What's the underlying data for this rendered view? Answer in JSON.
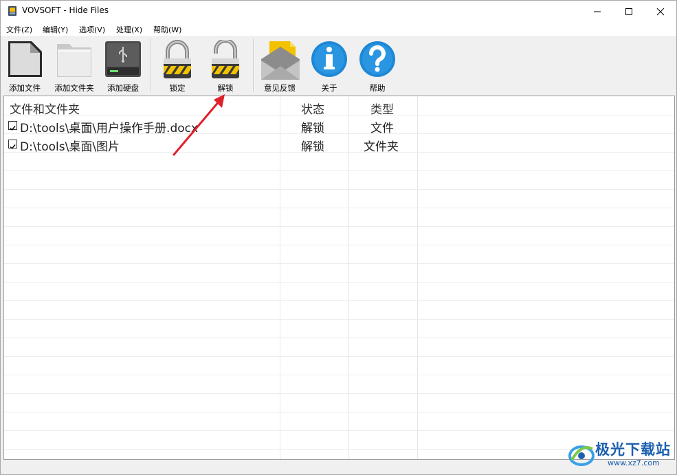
{
  "window": {
    "title": "VOVSOFT - Hide Files",
    "controls": [
      "minimize",
      "maximize",
      "close"
    ]
  },
  "menu": {
    "items": [
      "文件(Z)",
      "编辑(Y)",
      "选项(V)",
      "处理(X)",
      "帮助(W)"
    ]
  },
  "toolbar": {
    "add_file": "添加文件",
    "add_folder": "添加文件夹",
    "add_drive": "添加硬盘",
    "lock": "锁定",
    "unlock": "解锁",
    "feedback": "意见反馈",
    "about": "关于",
    "help": "帮助"
  },
  "table": {
    "columns": [
      "文件和文件夹",
      "状态",
      "类型"
    ],
    "rows": [
      {
        "checked": true,
        "path": "D:\\tools\\桌面\\用户操作手册.docx",
        "status": "解锁",
        "type": "文件"
      },
      {
        "checked": true,
        "path": "D:\\tools\\桌面\\图片",
        "status": "解锁",
        "type": "文件夹"
      }
    ]
  },
  "annotation": {
    "arrow_color": "#e0202a"
  },
  "watermark": {
    "text": "极光下载站",
    "url": "www.xz7.com"
  },
  "colors": {
    "info_blue": "#1e88d6",
    "lock_yellow": "#f2c200",
    "watermark_blue": "#1b5fae"
  }
}
